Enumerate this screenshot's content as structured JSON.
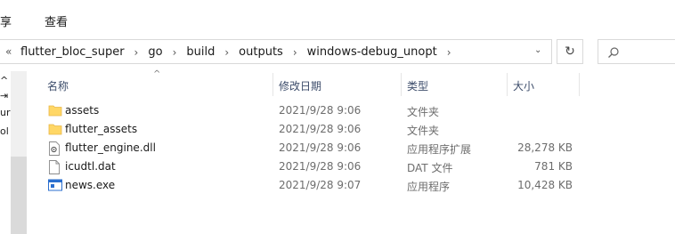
{
  "ribbon": {
    "tabs": [
      {
        "label": "享"
      },
      {
        "label": "查看"
      }
    ]
  },
  "address": {
    "overflow": "«",
    "crumbs": [
      "flutter_bloc_super",
      "go",
      "build",
      "outputs",
      "windows-debug_unopt"
    ],
    "separator": "›",
    "dropdown": "⌄",
    "refresh_glyph": "↻"
  },
  "nav_pane": {
    "fragments": [
      "^",
      "⇥",
      "ur",
      "",
      "ol"
    ]
  },
  "columns": [
    {
      "label": "名称"
    },
    {
      "label": "修改日期"
    },
    {
      "label": "类型"
    },
    {
      "label": "大小"
    }
  ],
  "sort_indicator": "^",
  "files": [
    {
      "name": "assets",
      "date": "2021/9/28 9:06",
      "type": "文件夹",
      "size": "",
      "icon": "folder-icon"
    },
    {
      "name": "flutter_assets",
      "date": "2021/9/28 9:06",
      "type": "文件夹",
      "size": "",
      "icon": "folder-icon"
    },
    {
      "name": "flutter_engine.dll",
      "date": "2021/9/28 9:06",
      "type": "应用程序扩展",
      "size": "28,278 KB",
      "icon": "dll-file-icon"
    },
    {
      "name": "icudtl.dat",
      "date": "2021/9/28 9:06",
      "type": "DAT 文件",
      "size": "781 KB",
      "icon": "blank-file-icon"
    },
    {
      "name": "news.exe",
      "date": "2021/9/28 9:07",
      "type": "应用程序",
      "size": "10,428 KB",
      "icon": "exe-file-icon"
    }
  ],
  "colors": {
    "folder": "#ffd766",
    "folder_dark": "#e8b84a",
    "header_text": "#3d4d6b",
    "meta_text": "#6d6d6d",
    "exe_blue": "#2b6fcf"
  }
}
